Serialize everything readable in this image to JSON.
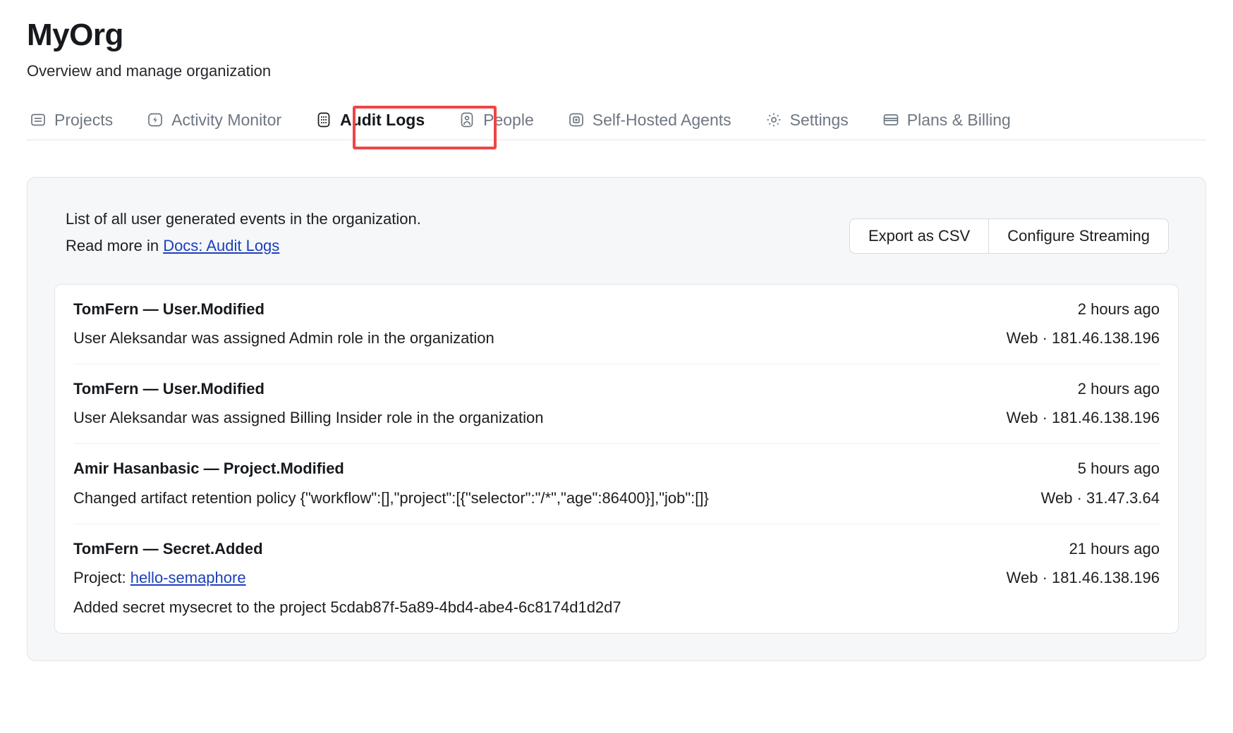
{
  "header": {
    "org_name": "MyOrg",
    "subtitle": "Overview and manage organization"
  },
  "tabs": [
    {
      "label": "Projects",
      "icon": "list-panel-icon",
      "active": false
    },
    {
      "label": "Activity Monitor",
      "icon": "lightning-bolt-icon",
      "active": false
    },
    {
      "label": "Audit Logs",
      "icon": "grid-dots-icon",
      "active": true
    },
    {
      "label": "People",
      "icon": "person-badge-icon",
      "active": false
    },
    {
      "label": "Self-Hosted Agents",
      "icon": "square-in-square-icon",
      "active": false
    },
    {
      "label": "Settings",
      "icon": "gear-icon",
      "active": false
    },
    {
      "label": "Plans & Billing",
      "icon": "credit-card-icon",
      "active": false
    }
  ],
  "panel": {
    "description_line1": "List of all user generated events in the organization.",
    "description_line2_prefix": "Read more in ",
    "docs_link_label": "Docs: Audit Logs",
    "export_csv_label": "Export as CSV",
    "configure_streaming_label": "Configure Streaming"
  },
  "logs": [
    {
      "title": "TomFern — User.Modified",
      "detail": "User Aleksandar was assigned Admin role in the organization",
      "time": "2 hours ago",
      "meta": "Web · 181.46.138.196"
    },
    {
      "title": "TomFern — User.Modified",
      "detail": "User Aleksandar was assigned Billing Insider role in the organization",
      "time": "2 hours ago",
      "meta": "Web · 181.46.138.196"
    },
    {
      "title": "Amir Hasanbasic — Project.Modified",
      "detail": "Changed artifact retention policy {\"workflow\":[],\"project\":[{\"selector\":\"/*\",\"age\":86400}],\"job\":[]}",
      "time": "5 hours ago",
      "meta": "Web · 31.47.3.64"
    },
    {
      "title": "TomFern — Secret.Added",
      "detail_prefix": "Project: ",
      "project_link": "hello-semaphore",
      "detail2": "Added secret mysecret to the project 5cdab87f-5a89-4bd4-abe4-6c8174d1d2d7",
      "time": "21 hours ago",
      "meta": "Web · 181.46.138.196"
    }
  ],
  "colors": {
    "highlight": "#ef4444",
    "link": "#1c3fba",
    "panel_bg": "#f5f7f9",
    "text": "#1c1e21",
    "muted": "#6e7781"
  }
}
